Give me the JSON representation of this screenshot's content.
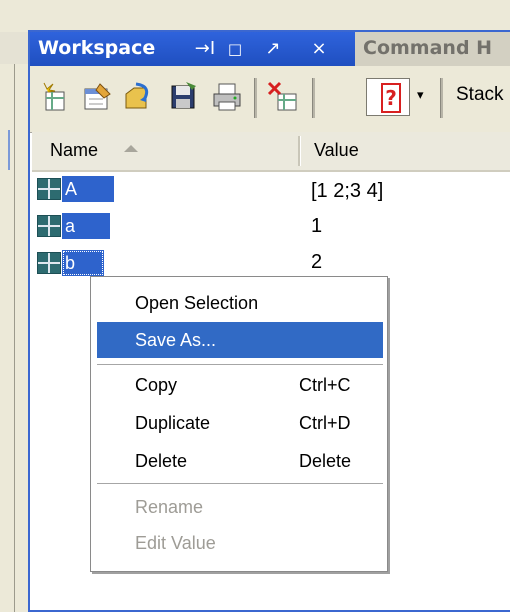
{
  "panel": {
    "active_tab": "Workspace",
    "inactive_tab": "Command H",
    "tab_buttons": [
      "→I",
      "□",
      "↗",
      "×"
    ]
  },
  "toolbar": {
    "icons": [
      "new-variable-icon",
      "open-selection-icon",
      "import-data-icon",
      "save-icon",
      "print-icon",
      "delete-icon"
    ],
    "help_label": "?",
    "dropdown_arrow": "▾",
    "stack_label": "Stack"
  },
  "columns": {
    "name": "Name",
    "value": "Value"
  },
  "variables": [
    {
      "name": "A",
      "value": "[1 2;3 4]"
    },
    {
      "name": "a",
      "value": "1"
    },
    {
      "name": "b",
      "value": "2"
    }
  ],
  "context_menu": {
    "open_selection": "Open Selection",
    "save_as": "Save As...",
    "copy": "Copy",
    "copy_shortcut": "Ctrl+C",
    "duplicate": "Duplicate",
    "duplicate_shortcut": "Ctrl+D",
    "delete": "Delete",
    "delete_shortcut": "Delete",
    "rename": "Rename",
    "edit_value": "Edit Value"
  },
  "colors": {
    "title_blue": "#2f63dc",
    "selection_blue": "#316ac5",
    "chrome": "#ece9d8"
  }
}
